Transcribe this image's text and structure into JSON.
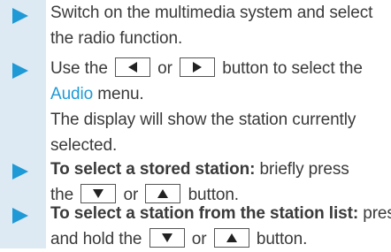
{
  "steps": [
    {
      "line1": "Switch on the multimedia system and select",
      "line2": "the radio function."
    },
    {
      "use_the": "Use the",
      "or": "or",
      "button_to_select": "button to select the",
      "audio_link": "Audio",
      "menu": " menu.",
      "display_line1": "The display will show the station currently",
      "display_line2": "selected."
    },
    {
      "bold_label": "To select a stored station:",
      "rest1": " briefly press",
      "the": "the",
      "or": "or",
      "button_end": "button."
    },
    {
      "bold_label": "To select a station from the station list:",
      "rest1": " press",
      "and_hold_the": "and hold the",
      "or": "or",
      "button_end": "button."
    }
  ],
  "icons": {
    "marker": "triangle-right-icon",
    "left": "triangle-left-icon",
    "right": "triangle-right-icon",
    "down": "triangle-down-icon",
    "up": "triangle-up-icon"
  },
  "colors": {
    "accent": "#1f9ad6",
    "sidebar": "#dde9f3",
    "text": "#3a3a3a"
  }
}
